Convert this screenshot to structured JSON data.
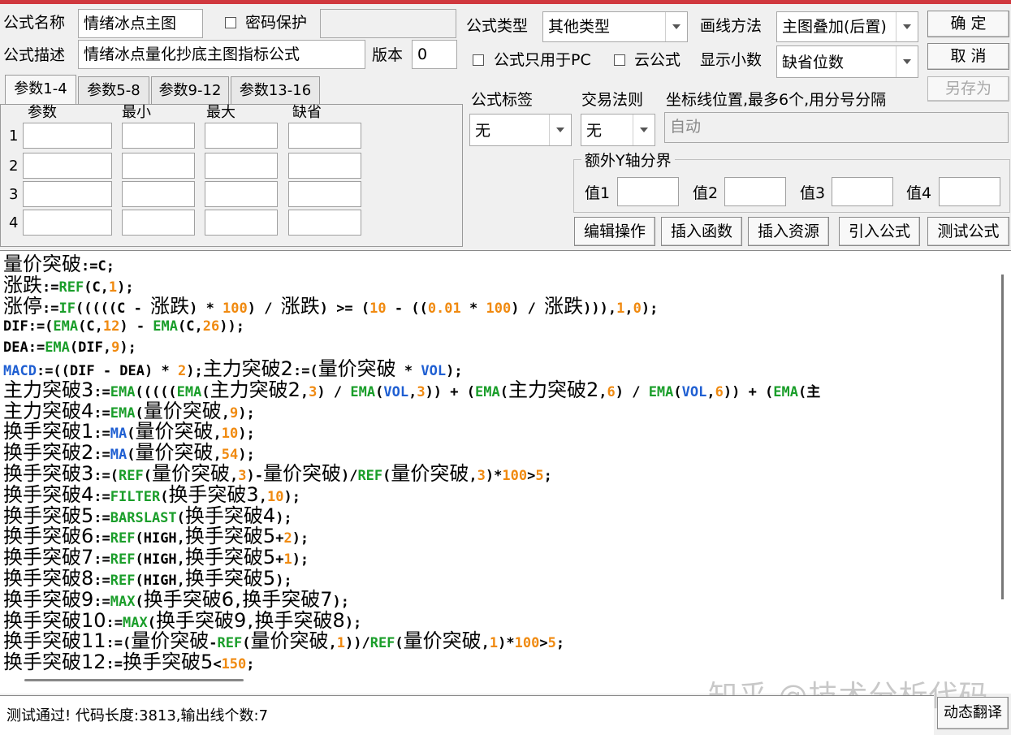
{
  "form": {
    "name_label": "公式名称",
    "name_value": "情绪冰点主图",
    "password_label": "密码保护",
    "password_value": "",
    "desc_label": "公式描述",
    "desc_value": "情绪冰点量化抄底主图指标公式",
    "version_label": "版本",
    "version_value": "0",
    "type_label": "公式类型",
    "type_value": "其他类型",
    "draw_label": "画线方法",
    "draw_value": "主图叠加(后置)",
    "pc_only_label": "公式只用于PC",
    "cloud_label": "云公式",
    "decimal_label": "显示小数",
    "decimal_value": "缺省位数",
    "tag_label": "公式标签",
    "tag_value": "无",
    "rule_label": "交易法则",
    "rule_value": "无",
    "coord_label": "坐标线位置,最多6个,用分号分隔",
    "coord_placeholder": "自动"
  },
  "buttons": {
    "ok": "确  定",
    "cancel": "取  消",
    "save_as": "另存为",
    "edit_ops": "编辑操作",
    "insert_func": "插入函数",
    "insert_res": "插入资源",
    "import_formula": "引入公式",
    "test_formula": "测试公式",
    "dyn_translate": "动态翻译"
  },
  "param_tabs": [
    "参数1-4",
    "参数5-8",
    "参数9-12",
    "参数13-16"
  ],
  "param_headers": [
    "参数",
    "最小",
    "最大",
    "缺省"
  ],
  "param_rows": [
    "1",
    "2",
    "3",
    "4"
  ],
  "extra_y": {
    "title": "额外Y轴分界",
    "labels": [
      "值1",
      "值2",
      "值3",
      "值4"
    ]
  },
  "code_lines": [
    [
      [
        "c",
        "量价突破"
      ],
      [
        "t",
        ":="
      ],
      [
        "t",
        "C"
      ],
      [
        "t",
        ";"
      ]
    ],
    [
      [
        "c",
        "涨跌"
      ],
      [
        "t",
        ":="
      ],
      [
        "f",
        "REF"
      ],
      [
        "t",
        "(C,"
      ],
      [
        "n",
        "1"
      ],
      [
        "t",
        ");"
      ]
    ],
    [
      [
        "c",
        "涨停"
      ],
      [
        "t",
        ":="
      ],
      [
        "f",
        "IF"
      ],
      [
        "t",
        "(((((C - "
      ],
      [
        "c",
        "涨跌"
      ],
      [
        "t",
        ") * "
      ],
      [
        "n",
        "100"
      ],
      [
        "t",
        ") / "
      ],
      [
        "c",
        "涨跌"
      ],
      [
        "t",
        ") >= ("
      ],
      [
        "n",
        "10"
      ],
      [
        "t",
        " - (("
      ],
      [
        "n",
        "0.01"
      ],
      [
        "t",
        " * "
      ],
      [
        "n",
        "100"
      ],
      [
        "t",
        ") / "
      ],
      [
        "c",
        "涨跌"
      ],
      [
        "t",
        ")))"
      ],
      [
        "t",
        ","
      ],
      [
        "n",
        "1"
      ],
      [
        "t",
        ","
      ],
      [
        "n",
        "0"
      ],
      [
        "t",
        ");"
      ]
    ],
    [
      [
        "t",
        "DIF:=("
      ],
      [
        "f",
        "EMA"
      ],
      [
        "t",
        "(C,"
      ],
      [
        "n",
        "12"
      ],
      [
        "t",
        ") - "
      ],
      [
        "f",
        "EMA"
      ],
      [
        "t",
        "(C,"
      ],
      [
        "n",
        "26"
      ],
      [
        "t",
        "));"
      ]
    ],
    [
      [
        "t",
        "DEA:="
      ],
      [
        "f",
        "EMA"
      ],
      [
        "t",
        "(DIF,"
      ],
      [
        "n",
        "9"
      ],
      [
        "t",
        ");"
      ]
    ],
    [
      [
        "v",
        "MACD"
      ],
      [
        "t",
        ":=((DIF - DEA) * "
      ],
      [
        "n",
        "2"
      ],
      [
        "t",
        ");"
      ],
      [
        "c",
        "主力突破2"
      ],
      [
        "t",
        ":=("
      ],
      [
        "c",
        "量价突破"
      ],
      [
        "t",
        " * "
      ],
      [
        "v",
        "VOL"
      ],
      [
        "t",
        ");"
      ]
    ],
    [
      [
        "c",
        "主力突破3"
      ],
      [
        "t",
        ":="
      ],
      [
        "f",
        "EMA"
      ],
      [
        "t",
        "((((("
      ],
      [
        "f",
        "EMA"
      ],
      [
        "t",
        "("
      ],
      [
        "c",
        "主力突破2"
      ],
      [
        "t",
        ","
      ],
      [
        "n",
        "3"
      ],
      [
        "t",
        ") / "
      ],
      [
        "f",
        "EMA"
      ],
      [
        "t",
        "("
      ],
      [
        "v",
        "VOL"
      ],
      [
        "t",
        ","
      ],
      [
        "n",
        "3"
      ],
      [
        "t",
        ")) + ("
      ],
      [
        "f",
        "EMA"
      ],
      [
        "t",
        "("
      ],
      [
        "c",
        "主力突破2"
      ],
      [
        "t",
        ","
      ],
      [
        "n",
        "6"
      ],
      [
        "t",
        ") / "
      ],
      [
        "f",
        "EMA"
      ],
      [
        "t",
        "("
      ],
      [
        "v",
        "VOL"
      ],
      [
        "t",
        ","
      ],
      [
        "n",
        "6"
      ],
      [
        "t",
        ")) + ("
      ],
      [
        "f",
        "EMA"
      ],
      [
        "t",
        "(主"
      ]
    ],
    [
      [
        "c",
        "主力突破4"
      ],
      [
        "t",
        ":="
      ],
      [
        "f",
        "EMA"
      ],
      [
        "t",
        "("
      ],
      [
        "c",
        "量价突破"
      ],
      [
        "t",
        ","
      ],
      [
        "n",
        "9"
      ],
      [
        "t",
        ");"
      ]
    ],
    [
      [
        "c",
        "换手突破1"
      ],
      [
        "t",
        ":="
      ],
      [
        "v",
        "MA"
      ],
      [
        "t",
        "("
      ],
      [
        "c",
        "量价突破"
      ],
      [
        "t",
        ","
      ],
      [
        "n",
        "10"
      ],
      [
        "t",
        ");"
      ]
    ],
    [
      [
        "c",
        "换手突破2"
      ],
      [
        "t",
        ":="
      ],
      [
        "v",
        "MA"
      ],
      [
        "t",
        "("
      ],
      [
        "c",
        "量价突破"
      ],
      [
        "t",
        ","
      ],
      [
        "n",
        "54"
      ],
      [
        "t",
        ");"
      ]
    ],
    [
      [
        "c",
        "换手突破3"
      ],
      [
        "t",
        ":=("
      ],
      [
        "f",
        "REF"
      ],
      [
        "t",
        "("
      ],
      [
        "c",
        "量价突破"
      ],
      [
        "t",
        ","
      ],
      [
        "n",
        "3"
      ],
      [
        "t",
        ")-"
      ],
      [
        "c",
        "量价突破"
      ],
      [
        "t",
        ")/"
      ],
      [
        "f",
        "REF"
      ],
      [
        "t",
        "("
      ],
      [
        "c",
        "量价突破"
      ],
      [
        "t",
        ","
      ],
      [
        "n",
        "3"
      ],
      [
        "t",
        ")*"
      ],
      [
        "n",
        "100"
      ],
      [
        "t",
        ">"
      ],
      [
        "n",
        "5"
      ],
      [
        "t",
        ";"
      ]
    ],
    [
      [
        "c",
        "换手突破4"
      ],
      [
        "t",
        ":="
      ],
      [
        "f",
        "FILTER"
      ],
      [
        "t",
        "("
      ],
      [
        "c",
        "换手突破3"
      ],
      [
        "t",
        ","
      ],
      [
        "n",
        "10"
      ],
      [
        "t",
        ");"
      ]
    ],
    [
      [
        "c",
        "换手突破5"
      ],
      [
        "t",
        ":="
      ],
      [
        "f",
        "BARSLAST"
      ],
      [
        "t",
        "("
      ],
      [
        "c",
        "换手突破4"
      ],
      [
        "t",
        ");"
      ]
    ],
    [
      [
        "c",
        "换手突破6"
      ],
      [
        "t",
        ":="
      ],
      [
        "f",
        "REF"
      ],
      [
        "t",
        "(HIGH,"
      ],
      [
        "c",
        "换手突破5"
      ],
      [
        "t",
        "+"
      ],
      [
        "n",
        "2"
      ],
      [
        "t",
        ");"
      ]
    ],
    [
      [
        "c",
        "换手突破7"
      ],
      [
        "t",
        ":="
      ],
      [
        "f",
        "REF"
      ],
      [
        "t",
        "(HIGH,"
      ],
      [
        "c",
        "换手突破5"
      ],
      [
        "t",
        "+"
      ],
      [
        "n",
        "1"
      ],
      [
        "t",
        ");"
      ]
    ],
    [
      [
        "c",
        "换手突破8"
      ],
      [
        "t",
        ":="
      ],
      [
        "f",
        "REF"
      ],
      [
        "t",
        "(HIGH,"
      ],
      [
        "c",
        "换手突破5"
      ],
      [
        "t",
        ");"
      ]
    ],
    [
      [
        "c",
        "换手突破9"
      ],
      [
        "t",
        ":="
      ],
      [
        "f",
        "MAX"
      ],
      [
        "t",
        "("
      ],
      [
        "c",
        "换手突破6"
      ],
      [
        "t",
        ","
      ],
      [
        "c",
        "换手突破7"
      ],
      [
        "t",
        ");"
      ]
    ],
    [
      [
        "c",
        "换手突破10"
      ],
      [
        "t",
        ":="
      ],
      [
        "f",
        "MAX"
      ],
      [
        "t",
        "("
      ],
      [
        "c",
        "换手突破9"
      ],
      [
        "t",
        ","
      ],
      [
        "c",
        "换手突破8"
      ],
      [
        "t",
        ");"
      ]
    ],
    [
      [
        "c",
        "换手突破11"
      ],
      [
        "t",
        ":=("
      ],
      [
        "c",
        "量价突破"
      ],
      [
        "t",
        "-"
      ],
      [
        "f",
        "REF"
      ],
      [
        "t",
        "("
      ],
      [
        "c",
        "量价突破"
      ],
      [
        "t",
        ","
      ],
      [
        "n",
        "1"
      ],
      [
        "t",
        "))/"
      ],
      [
        "f",
        "REF"
      ],
      [
        "t",
        "("
      ],
      [
        "c",
        "量价突破"
      ],
      [
        "t",
        ","
      ],
      [
        "n",
        "1"
      ],
      [
        "t",
        ")*"
      ],
      [
        "n",
        "100"
      ],
      [
        "t",
        ">"
      ],
      [
        "n",
        "5"
      ],
      [
        "t",
        ";"
      ]
    ],
    [
      [
        "c",
        "换手突破12"
      ],
      [
        "t",
        ":="
      ],
      [
        "c",
        "换手突破5"
      ],
      [
        "t",
        "<"
      ],
      [
        "n",
        "150"
      ],
      [
        "t",
        ";"
      ]
    ]
  ],
  "status_text": "测试通过! 代码长度:3813,输出线个数:7",
  "watermark": "知乎 @技术分析代码",
  "colors": {
    "function": "#1a9e2a",
    "number": "#f08a10",
    "variable": "#1f5fd2",
    "title_bar": "#d0383e"
  }
}
